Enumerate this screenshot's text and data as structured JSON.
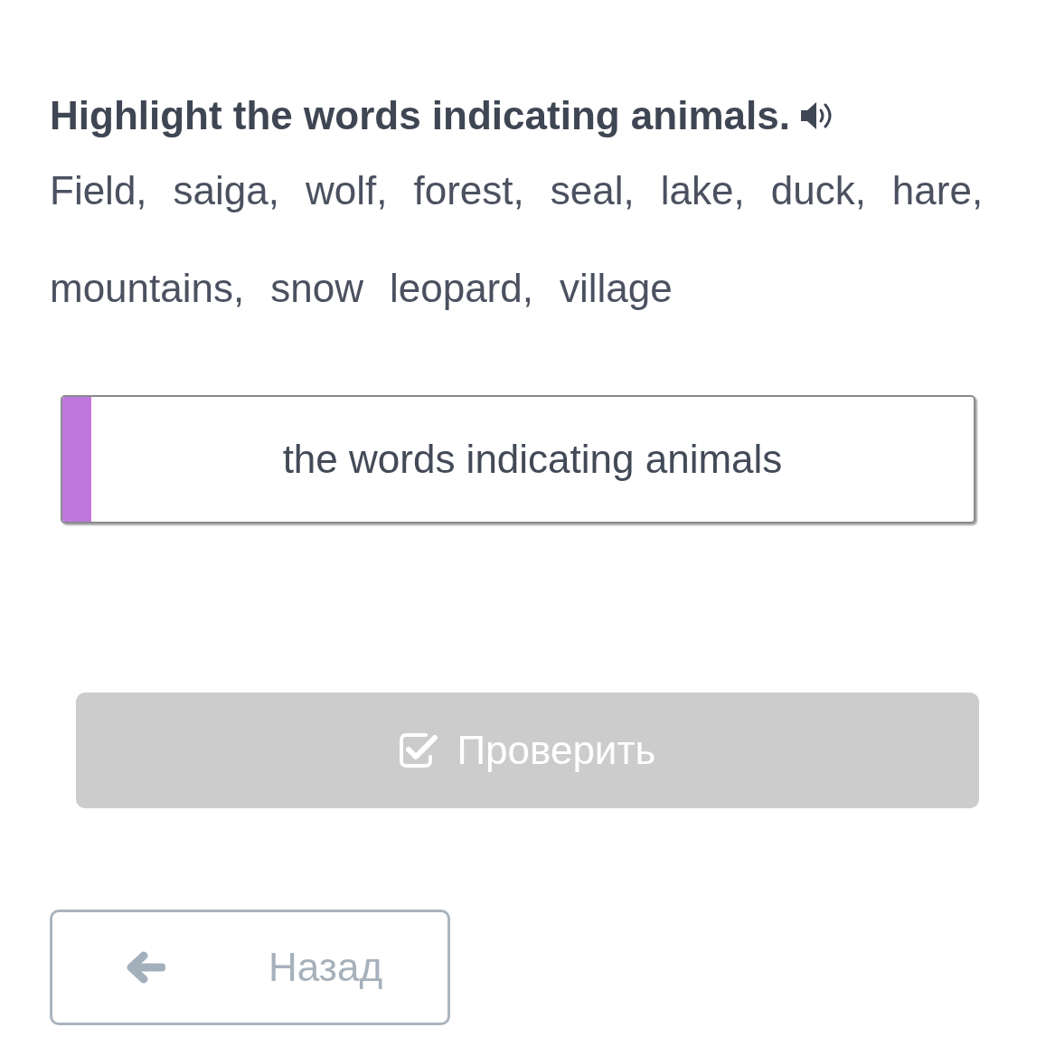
{
  "question": {
    "text": "Highlight the words indicating animals."
  },
  "words": [
    {
      "text": "Field,",
      "selected": false
    },
    {
      "text": "saiga,",
      "selected": false
    },
    {
      "text": "wolf,",
      "selected": false
    },
    {
      "text": "forest,",
      "selected": false
    },
    {
      "text": "seal,",
      "selected": false
    },
    {
      "text": "lake,",
      "selected": false
    },
    {
      "text": "duck,",
      "selected": false
    },
    {
      "text": "hare,",
      "selected": false
    },
    {
      "text": "mountains,",
      "selected": false
    },
    {
      "text": "snow",
      "selected": false
    },
    {
      "text": "leopard,",
      "selected": false
    },
    {
      "text": "village",
      "selected": false
    }
  ],
  "category": {
    "label": "the words indicating animals",
    "color": "#c077dd"
  },
  "check_button": {
    "label": "Проверить",
    "disabled": true
  },
  "back_button": {
    "label": "Назад"
  }
}
